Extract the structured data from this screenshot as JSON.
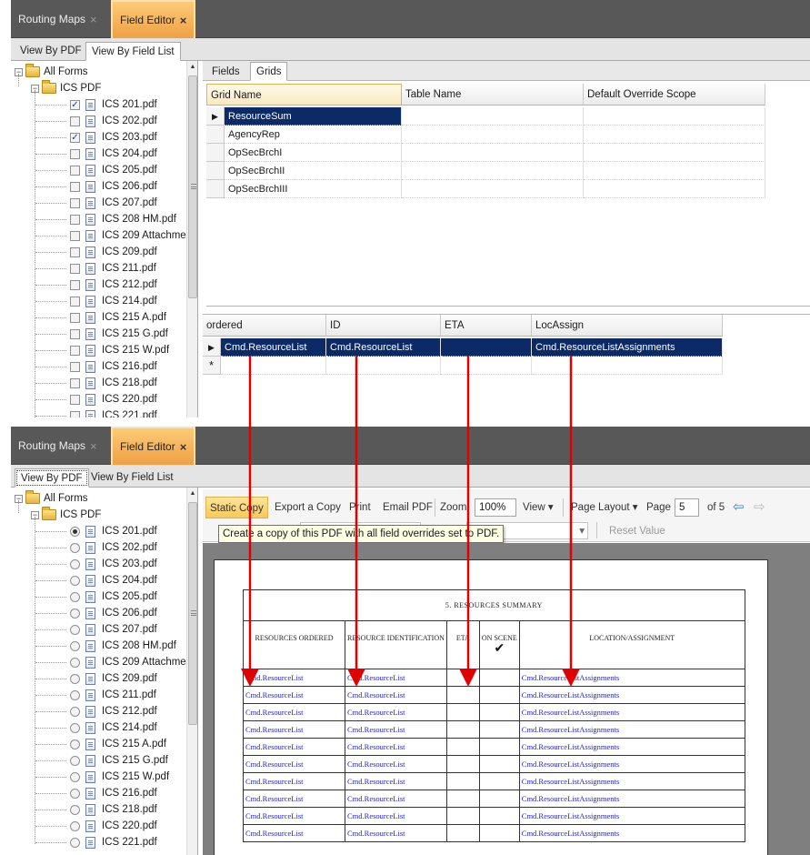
{
  "colors": {
    "arrow": "#e00000",
    "selection": "#0c2a66",
    "active_tab": "#f7b456",
    "titlebar": "#585858"
  },
  "doc_tabs": [
    {
      "label": "Routing Maps",
      "close": "×"
    },
    {
      "label": "Field Editor",
      "close": "×"
    }
  ],
  "view_tabs": [
    "View By PDF",
    "View By Field List"
  ],
  "tree": {
    "root": "All Forms",
    "folder": "ICS PDF",
    "expand_glyph": "−",
    "items": [
      "ICS 201.pdf",
      "ICS 202.pdf",
      "ICS 203.pdf",
      "ICS 204.pdf",
      "ICS 205.pdf",
      "ICS 206.pdf",
      "ICS 207.pdf",
      "ICS 208 HM.pdf",
      "ICS 209 Attachme",
      "ICS 209.pdf",
      "ICS 211.pdf",
      "ICS 212.pdf",
      "ICS 214.pdf",
      "ICS 215 A.pdf",
      "ICS 215 G.pdf",
      "ICS 215 W.pdf",
      "ICS 216.pdf",
      "ICS 218.pdf",
      "ICS 220.pdf",
      "ICS 221.pdf"
    ],
    "checked": [
      true,
      false,
      true,
      false,
      false,
      false,
      false,
      false,
      false,
      false,
      false,
      false,
      false,
      false,
      false,
      false,
      false,
      false,
      false,
      false
    ],
    "radio_selected_index": 0,
    "check_glyph": "✓"
  },
  "scroll_glyphs": {
    "up": "▲",
    "down": "▼"
  },
  "field_editor": {
    "inner_tabs": [
      "Fields",
      "Grids"
    ],
    "grids_headers": [
      "Grid Name",
      "Table Name",
      "Default Override Scope"
    ],
    "grids_rows": [
      "ResourceSum",
      "AgencyRep",
      "OpSecBrchI",
      "OpSecBrchII",
      "OpSecBrchIII"
    ],
    "columns_headers": [
      "ordered",
      "ID",
      "ETA",
      "LocAssign"
    ],
    "columns_row": [
      "Cmd.ResourceList",
      "Cmd.ResourceList",
      "",
      "Cmd.ResourceListAssignments"
    ],
    "row_pointer": "▶",
    "new_row_marker": "*"
  },
  "toolbar": {
    "static_copy": "Static Copy",
    "export_copy": "Export a Copy",
    "print": "Print",
    "email_pdf": "Email PDF",
    "zoom_label": "Zoom",
    "zoom_value": "100%",
    "view": "View",
    "page_layout": "Page Layout",
    "page_label": "Page",
    "page_value": "5",
    "page_of": "of 5",
    "reset_value": "Reset Value",
    "dropdown_glyph": "▾",
    "nav_prev_glyph": "⇦",
    "nav_next_glyph": "⇨",
    "tooltip": "Create a copy of this PDF with all field overrides set to PDF."
  },
  "pdf_form": {
    "title": "5. RESOURCES SUMMARY",
    "headers": [
      "RESOURCES ORDERED",
      "RESOURCE IDENTIFICATION",
      "ETA",
      "ON SCENE",
      "LOCATION/ASSIGNMENT"
    ],
    "onscene_mark": "✔",
    "row_values": [
      "Cmd.ResourceList",
      "Cmd.ResourceList",
      "",
      "",
      "Cmd.ResourceListAssignments"
    ],
    "row_count": 10
  }
}
